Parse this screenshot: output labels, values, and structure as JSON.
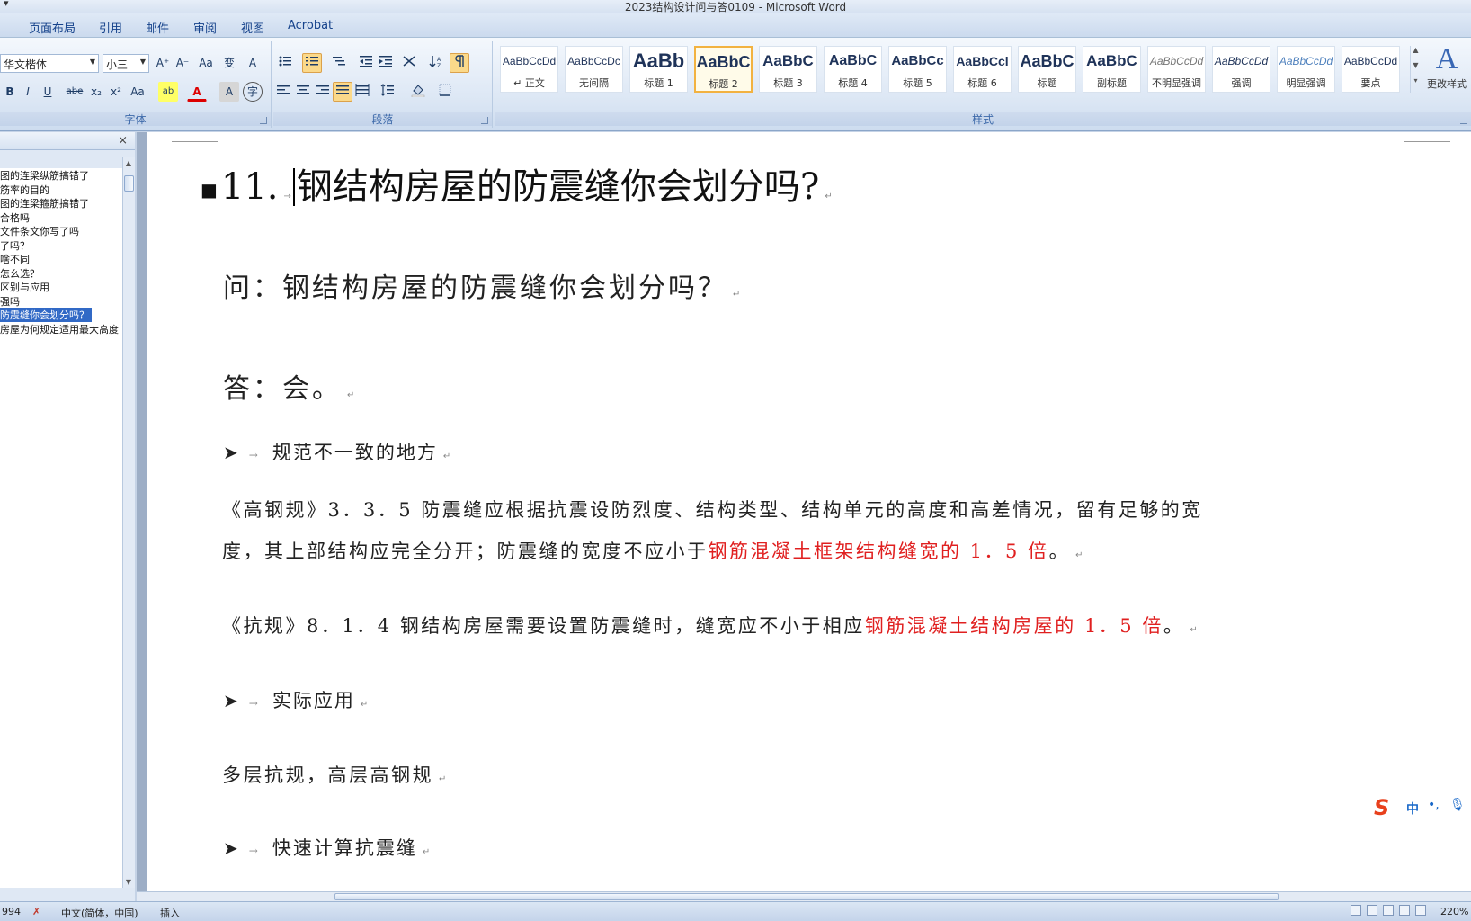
{
  "window": {
    "title": "2023结构设计问与答0109 - Microsoft Word",
    "quick_access": "▾"
  },
  "tabs": [
    "页面布局",
    "引用",
    "邮件",
    "审阅",
    "视图",
    "Acrobat"
  ],
  "ribbon": {
    "font_group": {
      "label": "字体",
      "font_name": "华文楷体",
      "font_size": "小三",
      "buttons": [
        "A⁺",
        "A⁻",
        "Aa",
        "变",
        "A",
        "B",
        "I",
        "U",
        "abe",
        "x₂",
        "x²",
        "Aa",
        "ab",
        "A",
        "A",
        "字"
      ]
    },
    "paragraph_group": {
      "label": "段落"
    },
    "styles_group": {
      "label": "样式",
      "items": [
        {
          "sample": "AaBbCcDd",
          "name": "↵ 正文",
          "size": 12
        },
        {
          "sample": "AaBbCcDc",
          "name": "无间隔",
          "size": 12
        },
        {
          "sample": "AaBb",
          "name": "标题 1",
          "size": 22
        },
        {
          "sample": "AaBbC",
          "name": "标题 2",
          "size": 18
        },
        {
          "sample": "AaBbC",
          "name": "标题 3",
          "size": 17
        },
        {
          "sample": "AaBbC",
          "name": "标题 4",
          "size": 16
        },
        {
          "sample": "AaBbCc",
          "name": "标题 5",
          "size": 15
        },
        {
          "sample": "AaBbCcl",
          "name": "标题 6",
          "size": 14
        },
        {
          "sample": "AaBbC",
          "name": "标题",
          "size": 18
        },
        {
          "sample": "AaBbC",
          "name": "副标题",
          "size": 17
        },
        {
          "sample": "AaBbCcDd",
          "name": "不明显强调",
          "size": 12
        },
        {
          "sample": "AaBbCcDd",
          "name": "强调",
          "size": 12
        },
        {
          "sample": "AaBbCcDd",
          "name": "明显强调",
          "size": 12
        },
        {
          "sample": "AaBbCcDd",
          "name": "要点",
          "size": 12
        }
      ],
      "selected_index": 3,
      "change_styles_label": "更改样式"
    }
  },
  "nav": {
    "close": "×",
    "items": [
      "图的连梁纵筋搞错了",
      "筋率的目的",
      "图的连梁箍筋搞错了",
      "合格吗",
      "文件条文你写了吗",
      "了吗？",
      "啥不同",
      "怎么选？",
      "区别与应用",
      "强吗",
      "防震缝你会划分吗？",
      "房屋为何规定适用最大高度"
    ],
    "selected_index": 10
  },
  "document": {
    "heading_number": "11.",
    "heading_text": "钢结构房屋的防震缝你会划分吗?",
    "question": "问：钢结构房屋的防震缝你会划分吗？",
    "answer": "答：会。",
    "bullet1": "规范不一致的地方",
    "p1_line1": "《高钢规》3．3．5 防震缝应根据抗震设防烈度、结构类型、结构单元的高度和高差情况，留有足够的宽",
    "p1_line2_a": "度，其上部结构应完全分开；防震缝的宽度不应小于",
    "p1_line2_red": "钢筋混凝土框架结构缝宽的 1．5 倍",
    "p1_line2_end": "。",
    "p2_a": "《抗规》8．1．4 钢结构房屋需要设置防震缝时，缝宽应不小于相应",
    "p2_red": "钢筋混凝土结构房屋的 1．5 倍",
    "p2_end": "。",
    "bullet2": "实际应用",
    "p3": "多层抗规，高层高钢规",
    "bullet3": "快速计算抗震缝",
    "para_mark": "↵",
    "tab_arrow": "→"
  },
  "ime": {
    "logo": "S",
    "mode": "中",
    "punct": "•,",
    "mic": "🎙"
  },
  "status": {
    "page": "994",
    "language": "中文(简体，中国)",
    "mode": "插入",
    "zoom": "220%"
  }
}
